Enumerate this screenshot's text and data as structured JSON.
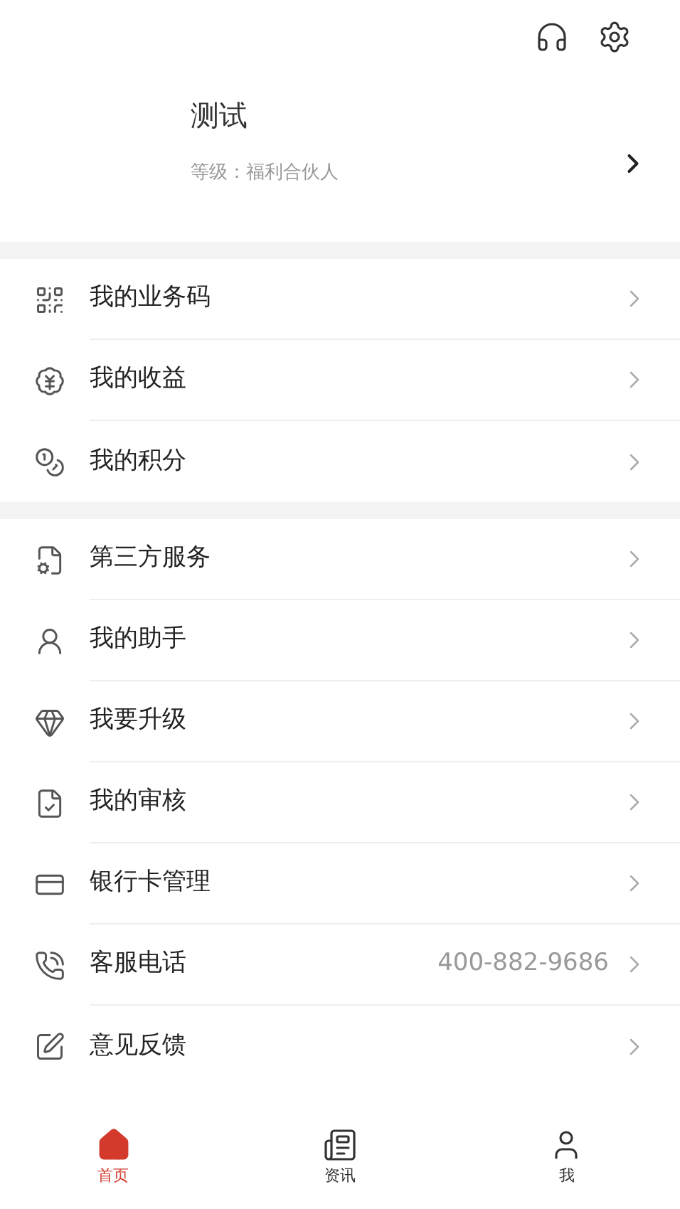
{
  "profile": {
    "name": "测试",
    "level_text": "等级：福利合伙人"
  },
  "sections": [
    {
      "items": [
        {
          "label": "我的业务码"
        },
        {
          "label": "我的收益"
        },
        {
          "label": "我的积分"
        }
      ]
    },
    {
      "items": [
        {
          "label": "第三方服务"
        },
        {
          "label": "我的助手"
        },
        {
          "label": "我要升级"
        },
        {
          "label": "我的审核"
        },
        {
          "label": "银行卡管理"
        },
        {
          "label": "客服电话",
          "value": "400-882-9686"
        },
        {
          "label": "意见反馈"
        }
      ]
    }
  ],
  "tabs": [
    {
      "label": "首页",
      "selected": true
    },
    {
      "label": "资讯",
      "selected": false
    },
    {
      "label": "我",
      "selected": false
    }
  ]
}
